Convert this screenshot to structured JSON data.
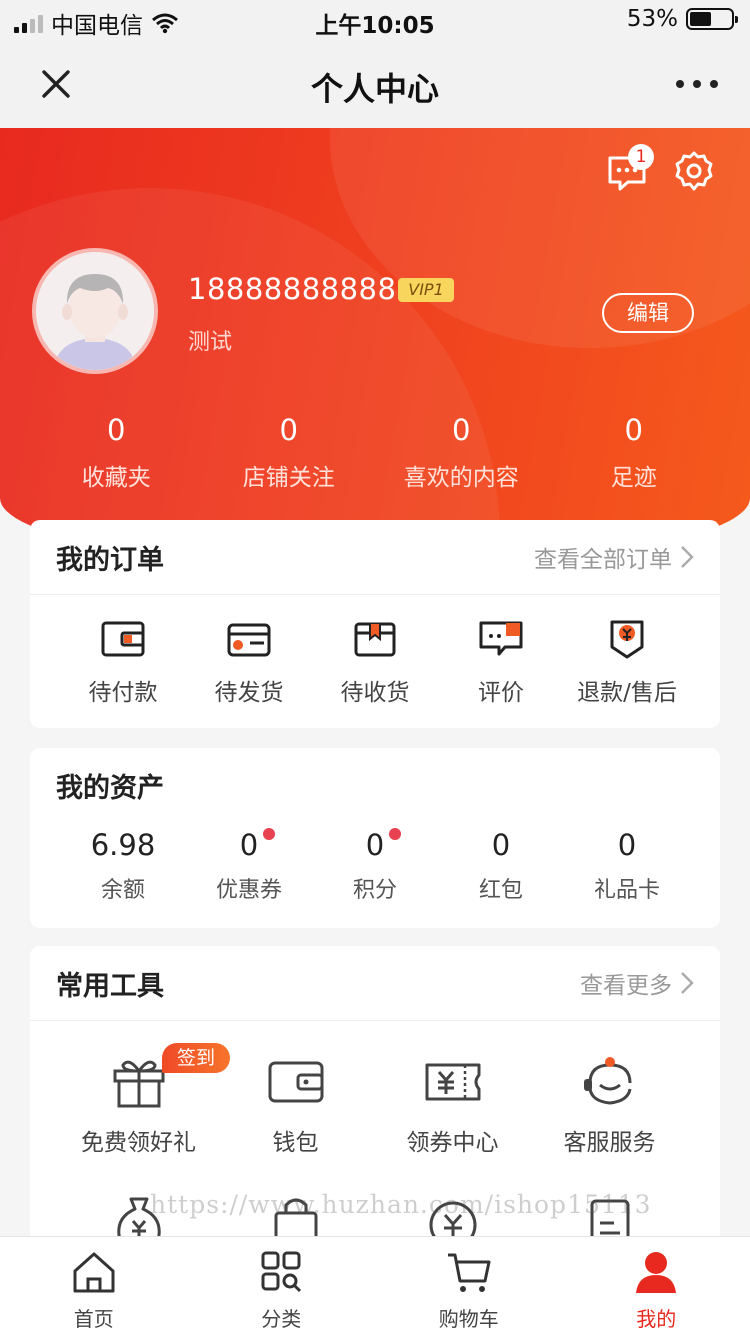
{
  "status_bar": {
    "carrier": "中国电信",
    "time": "上午10:05",
    "battery": "53%",
    "battery_level": 0.53
  },
  "nav": {
    "title": "个人中心",
    "close_icon": "close-icon",
    "more_icon": "more-dots-icon"
  },
  "profile": {
    "message_count": "1",
    "phone": "18888888888",
    "vip": "VIP1",
    "nickname": "测试",
    "edit_label": "编辑",
    "stats": [
      {
        "value": "0",
        "label": "收藏夹"
      },
      {
        "value": "0",
        "label": "店铺关注"
      },
      {
        "value": "0",
        "label": "喜欢的内容"
      },
      {
        "value": "0",
        "label": "足迹"
      }
    ]
  },
  "orders": {
    "title": "我的订单",
    "more": "查看全部订单",
    "items": [
      {
        "label": "待付款",
        "icon": "wallet-icon"
      },
      {
        "label": "待发货",
        "icon": "card-icon"
      },
      {
        "label": "待收货",
        "icon": "box-icon"
      },
      {
        "label": "评价",
        "icon": "comment-icon"
      },
      {
        "label": "退款/售后",
        "icon": "refund-icon"
      }
    ]
  },
  "assets": {
    "title": "我的资产",
    "items": [
      {
        "value": "6.98",
        "label": "余额"
      },
      {
        "value": "0",
        "label": "优惠券"
      },
      {
        "value": "0",
        "label": "积分"
      },
      {
        "value": "0",
        "label": "红包"
      },
      {
        "value": "0",
        "label": "礼品卡"
      }
    ]
  },
  "tools": {
    "title": "常用工具",
    "more": "查看更多",
    "items": [
      {
        "label": "免费领好礼",
        "badge": "签到",
        "icon": "gift-icon"
      },
      {
        "label": "钱包",
        "icon": "wallet-icon"
      },
      {
        "label": "领券中心",
        "icon": "coupon-icon"
      },
      {
        "label": "客服服务",
        "icon": "customer-service-icon"
      }
    ],
    "row2_icons": [
      "money-bag-icon",
      "shopping-bag-icon",
      "yuan-circle-icon",
      "document-icon"
    ]
  },
  "watermark": "https://www.huzhan.com/ishop15113",
  "tab_bar": [
    {
      "label": "首页",
      "icon": "home-icon"
    },
    {
      "label": "分类",
      "icon": "category-icon"
    },
    {
      "label": "购物车",
      "icon": "cart-icon"
    },
    {
      "label": "我的",
      "icon": "user-icon",
      "active": true
    }
  ],
  "colors": {
    "brand": "#e8291f",
    "accent": "#f55a1c",
    "vip": "#f8d55c"
  }
}
